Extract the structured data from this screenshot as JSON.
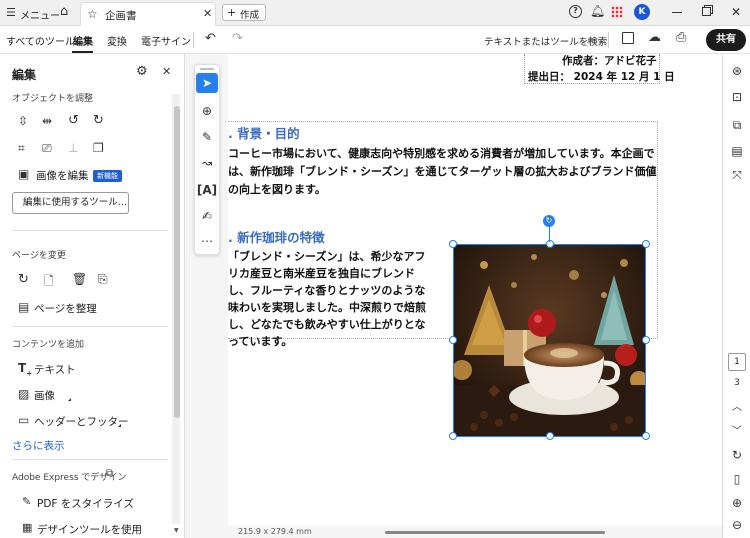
{
  "titlebar": {
    "menu_label": "メニュー",
    "tab_title": "企画書",
    "new_tab_label": "作成",
    "user_initial": "K"
  },
  "toolbar": {
    "tabs": [
      "すべてのツール",
      "編集",
      "変換",
      "電子サイン"
    ],
    "search_label": "テキストまたはツールを検索",
    "share_label": "共有"
  },
  "left_panel": {
    "title": "編集",
    "adjust_section": "オブジェクトを調整",
    "edit_image_label": "画像を編集",
    "new_badge": "新機能",
    "edit_tools_button": "編集に使用するツール...",
    "page_section": "ページを変更",
    "organize_pages_label": "ページを整理",
    "content_section": "コンテンツを追加",
    "text_label": "テキスト",
    "image_label": "画像",
    "header_footer_label": "ヘッダーとフッター",
    "more_link": "さらに表示",
    "express_section": "Adobe Express でデザイン",
    "stylize_label": "PDF をスタイライズ",
    "design_tools_label": "デザインツールを使用"
  },
  "document": {
    "author": "作成者：アドビ花子",
    "date": "提出日： 2024 年 12 月 1 日",
    "heading1": ". 背景・目的",
    "para1": [
      "コーヒー市場において、健康志向や特別感を求める消費者が増加しています。本企画で",
      "は、新作珈琲「ブレンド・シーズン」を通じてターゲット層の拡大およびブランド価値",
      "の向上を図ります。"
    ],
    "heading2": ". 新作珈琲の特徴",
    "para2": [
      "「ブレンド・シーズン」は、希少なアフ",
      "リカ産豆と南米産豆を独自にブレンド",
      "し、フルーティな香りとナッツのような",
      "味わいを実現しました。中深煎りで焙煎",
      "し、どなたでも飲みやすい仕上がりとな",
      "っています。"
    ]
  },
  "statusbar": {
    "page_size": "215.9 x 279.4 mm"
  },
  "right_bar": {
    "current_page": "1",
    "total_pages": "3"
  },
  "colors": {
    "accent": "#2680eb",
    "heading": "#3b6cc0",
    "share_bg": "#1b1b1b"
  }
}
